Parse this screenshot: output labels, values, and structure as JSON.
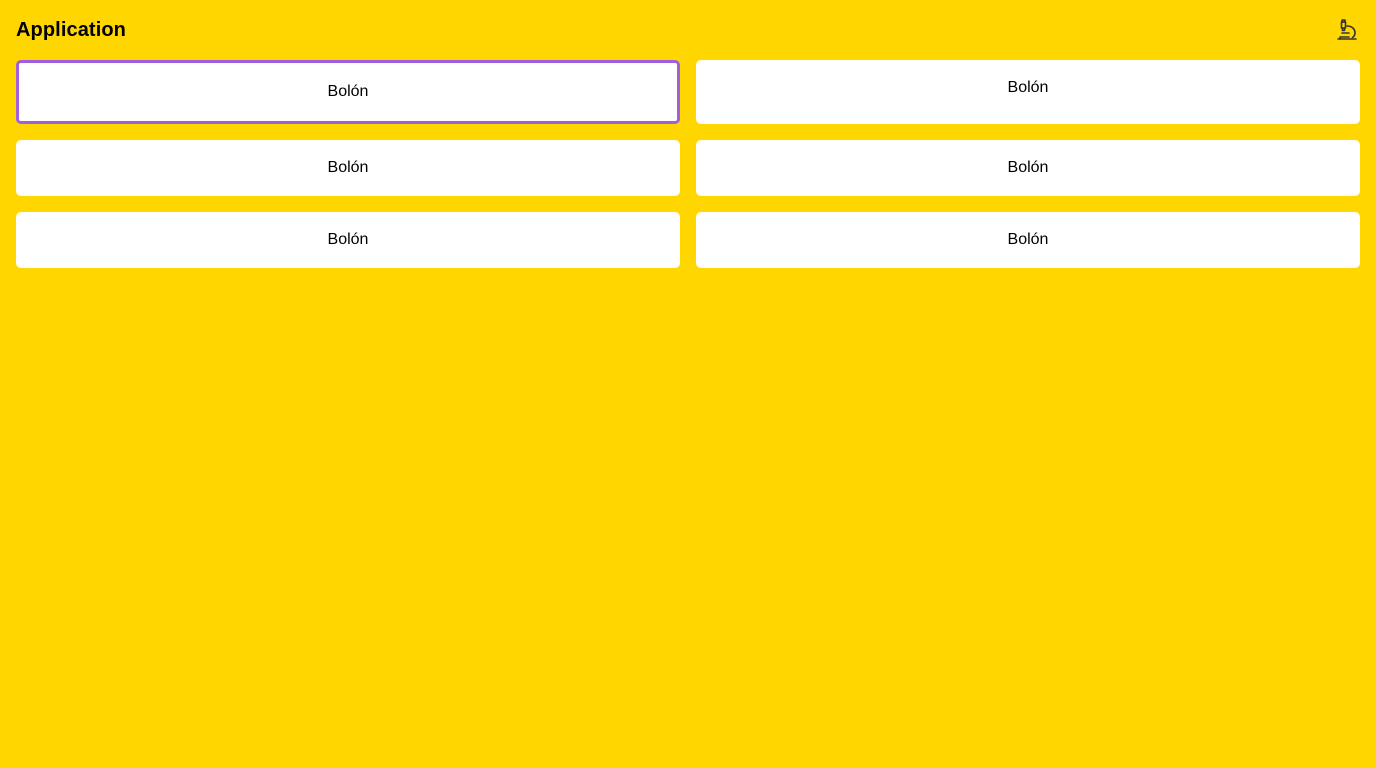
{
  "header": {
    "title": "Application",
    "action_icon": "microscope-icon"
  },
  "colors": {
    "background": "#FFD600",
    "tile": "#FFFFFF",
    "focus_ring": "#A05FDD"
  },
  "tiles": [
    {
      "label": "Bolón",
      "focused": true
    },
    {
      "label": "Bolón",
      "focused": false
    },
    {
      "label": "Bolón",
      "focused": false
    },
    {
      "label": "Bolón",
      "focused": false
    },
    {
      "label": "Bolón",
      "focused": false
    },
    {
      "label": "Bolón",
      "focused": false
    }
  ]
}
